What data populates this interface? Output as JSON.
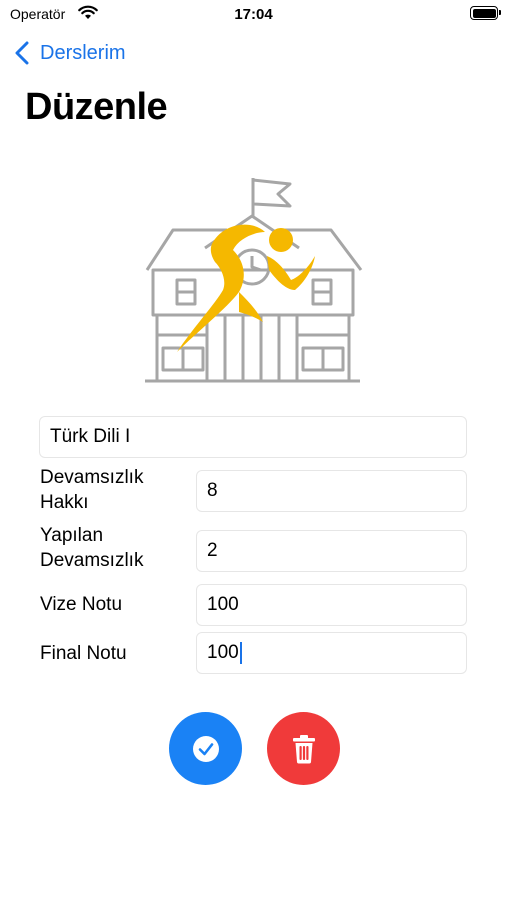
{
  "status_bar": {
    "carrier": "Operatör",
    "time": "17:04"
  },
  "nav": {
    "back_label": "Derslerim"
  },
  "page": {
    "title": "Düzenle"
  },
  "form": {
    "course_name": "Türk Dili I",
    "fields": [
      {
        "label_line1": "Devamsızlık",
        "label_line2": "Hakkı",
        "value": "8"
      },
      {
        "label_line1": "Yapılan",
        "label_line2": "Devamsızlık",
        "value": "2"
      },
      {
        "label": "Vize Notu",
        "value": "100"
      },
      {
        "label": "Final Notu",
        "value": "100"
      }
    ]
  },
  "colors": {
    "accent_blue": "#1a82f5",
    "delete_red": "#f03a3a",
    "runner_yellow": "#f5b800",
    "building_gray": "#a6a6a6"
  },
  "icons": {
    "save": "checkmark-icon",
    "delete": "trash-icon",
    "back": "chevron-left-icon"
  }
}
